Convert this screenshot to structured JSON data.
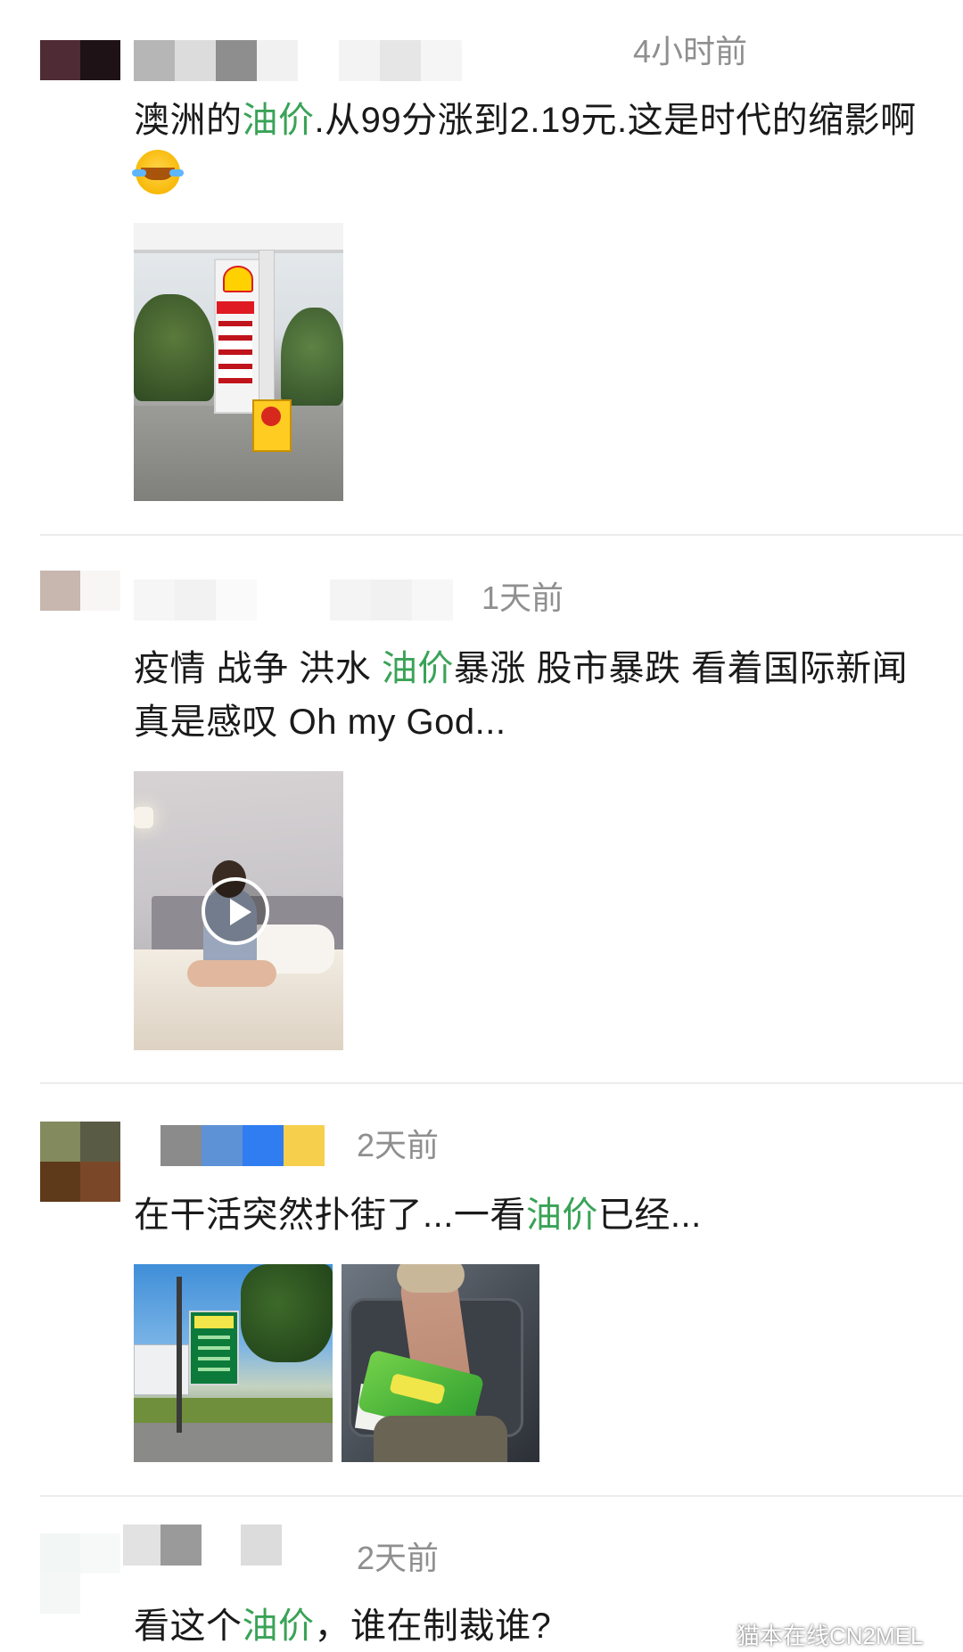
{
  "posts": [
    {
      "time": "4小时前",
      "text_parts": [
        "澳洲的",
        "油价",
        ".从99分涨到2.19元.这是时代的缩影啊"
      ],
      "emoji": "face-with-tears-of-joy-icon",
      "media": [
        "gas-station-photo"
      ]
    },
    {
      "time": "1天前",
      "text_parts": [
        "疫情 战争 洪水 ",
        "油价",
        "暴涨 股市暴跌 看着国际新闻 真是感叹 Oh my God..."
      ],
      "media": [
        "video-thumbnail"
      ]
    },
    {
      "time": "2天前",
      "text_parts": [
        "在干活突然扑街了...一看",
        "油价",
        "已经..."
      ],
      "media": [
        "petrol-price-sign-photo",
        "injured-knee-photo"
      ]
    },
    {
      "time": "2天前",
      "text_parts": [
        "看这个",
        "油价",
        "，谁在制裁谁?"
      ]
    }
  ],
  "watermark": "猫本在线CN2MEL",
  "colors": {
    "keyword": "#3aa357",
    "time": "#8f8f8f",
    "text": "#1a1a1a",
    "divider": "#ececec"
  }
}
